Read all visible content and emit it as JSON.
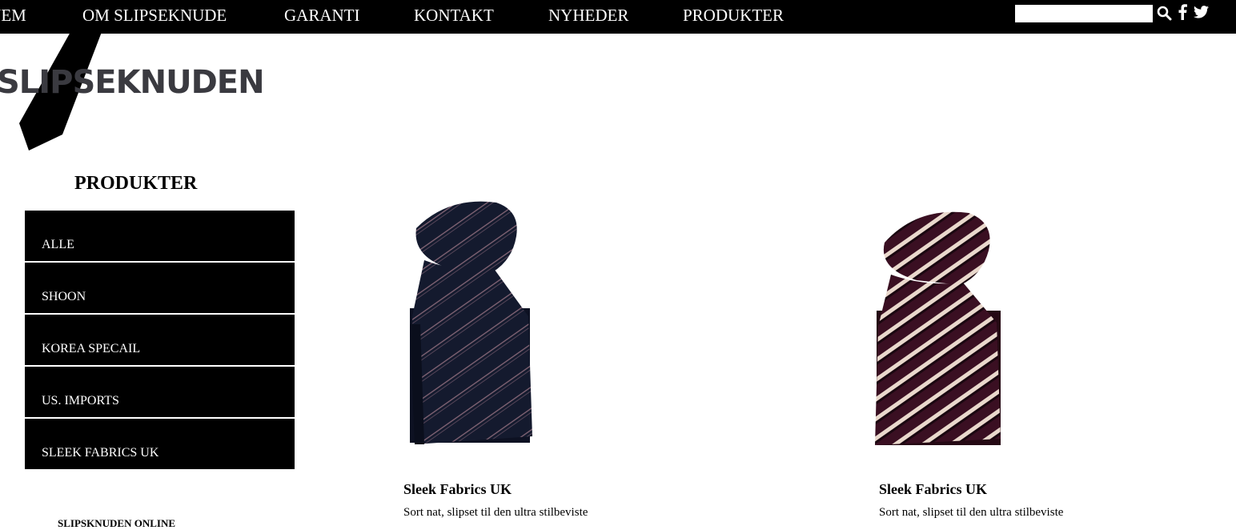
{
  "nav": {
    "items": [
      {
        "label": "HJEM"
      },
      {
        "label": "OM SLIPSEKNUDE"
      },
      {
        "label": "GARANTI"
      },
      {
        "label": "KONTAKT"
      },
      {
        "label": "NYHEDER"
      },
      {
        "label": "PRODUKTER"
      }
    ],
    "search_value": "",
    "icons": [
      "search-icon",
      "facebook-icon",
      "twitter-icon"
    ]
  },
  "logo": {
    "text": "SLIPSEKNUDEN"
  },
  "sidebar": {
    "title": "PRODUKTER",
    "items": [
      {
        "label": "ALLE"
      },
      {
        "label": "SHOON"
      },
      {
        "label": "KOREA SPECAIL"
      },
      {
        "label": "US. IMPORTS"
      },
      {
        "label": "SLEEK FABRICS UK"
      }
    ],
    "footer_text": "SLIPSKNUDEN ONLINE"
  },
  "products": [
    {
      "name": "Sleek Fabrics UK",
      "description": "Sort nat, slipset til den ultra stilbeviste",
      "image": "navy-striped-tie"
    },
    {
      "name": "Sleek Fabrics UK",
      "description": "Sort nat, slipset til den ultra stilbeviste",
      "image": "burgundy-striped-tie"
    }
  ],
  "colors": {
    "bar_bg": "#000000",
    "page_bg": "#ffffff",
    "logo_text": "#3a3a40",
    "tie_navy": "#141a2e",
    "tie_burgundy": "#3a0f22"
  }
}
